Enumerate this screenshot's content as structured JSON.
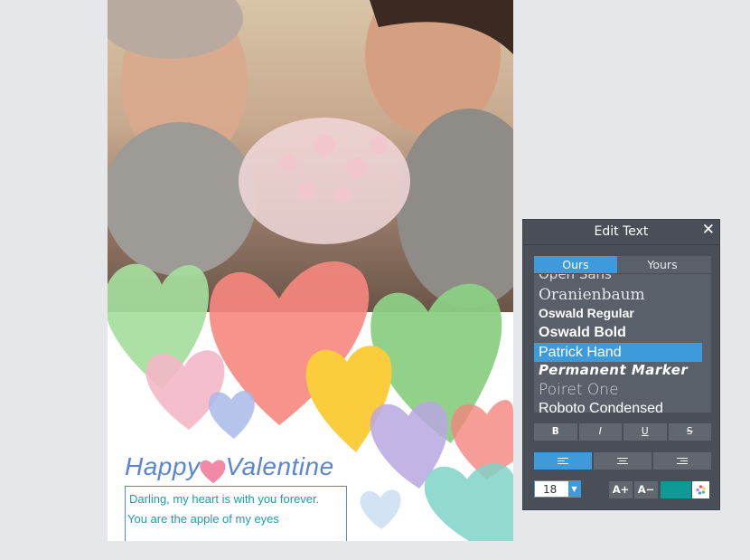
{
  "card": {
    "greeting_left": "Happy",
    "greeting_right": "Valentine",
    "message_line1": "Darling, my heart is with you forever.",
    "message_line2": "You are the apple of my eyes"
  },
  "panel": {
    "title": "Edit Text",
    "close_icon": "close-icon",
    "tabs": [
      {
        "label": "Ours",
        "active": true
      },
      {
        "label": "Yours",
        "active": false
      }
    ],
    "fonts": [
      {
        "label": "Open Sans"
      },
      {
        "label": "Oranienbaum"
      },
      {
        "label": "Oswald Regular"
      },
      {
        "label": "Oswald Bold"
      },
      {
        "label": "Patrick Hand",
        "selected": true
      },
      {
        "label": "Permanent Marker"
      },
      {
        "label": "Poiret One"
      },
      {
        "label": "Roboto Condensed"
      }
    ],
    "style_buttons": {
      "bold": "B",
      "italic": "I",
      "underline": "U",
      "strike": "S"
    },
    "font_size": "18",
    "size_up_label": "A+",
    "size_down_label": "A−",
    "text_color": "#0e9a95",
    "accent_color": "#3d9bdc"
  }
}
